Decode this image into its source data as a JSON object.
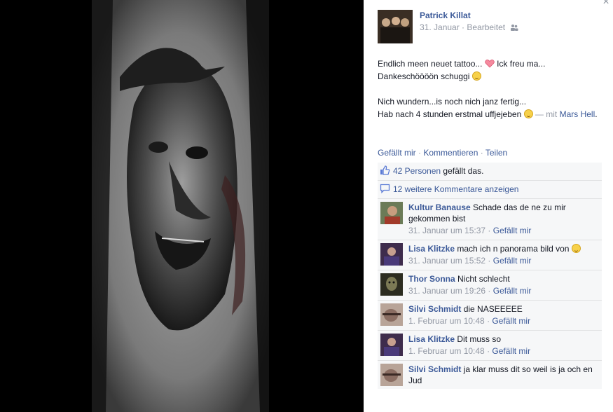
{
  "post": {
    "author": "Patrick Killat",
    "date": "31. Januar",
    "separator": " · ",
    "edited": "Bearbeitet",
    "text_line1a": "Endlich meen neuet tattoo... ",
    "text_line1b": " Ick freu ma...",
    "text_line2": "Dankeschöööön schuggi ",
    "text_line3": "Nich wundern...is noch nich janz fertig...",
    "text_line4a": "Hab nach 4 stunden erstmal uffjejeben ",
    "with_prefix": " — mit ",
    "tagged": "Mars Hell",
    "tagged_suffix": "."
  },
  "actions": {
    "like": "Gefällt mir",
    "sep": " · ",
    "comment": "Kommentieren",
    "share": "Teilen"
  },
  "likes": {
    "count": "42 Personen",
    "suffix": " gefällt das."
  },
  "more_comments": "12 weitere Kommentare anzeigen",
  "comments": [
    {
      "name": "Kultur Banause",
      "text": "Schade das de ne zu mir gekommen bist",
      "time": "31. Januar um 15:37",
      "like": "Gefällt mir"
    },
    {
      "name": "Lisa Klitzke",
      "text": "mach ich n panorama bild von ",
      "time": "31. Januar um 15:52",
      "like": "Gefällt mir"
    },
    {
      "name": "Thor Sonna",
      "text": "Nicht schlecht",
      "time": "31. Januar um 19:26",
      "like": "Gefällt mir"
    },
    {
      "name": "Silvi Schmidt",
      "text": "die NASEEEEE",
      "time": "1. Februar um 10:48",
      "like": "Gefällt mir"
    },
    {
      "name": "Lisa Klitzke",
      "text": "Dit muss so",
      "time": "1. Februar um 10:48",
      "like": "Gefällt mir"
    },
    {
      "name": "Silvi Schmidt",
      "text": "ja klar muss dit so weil is ja och en Jud",
      "time": "",
      "like": ""
    }
  ],
  "close_symbol": "×",
  "meta_sep": " · "
}
